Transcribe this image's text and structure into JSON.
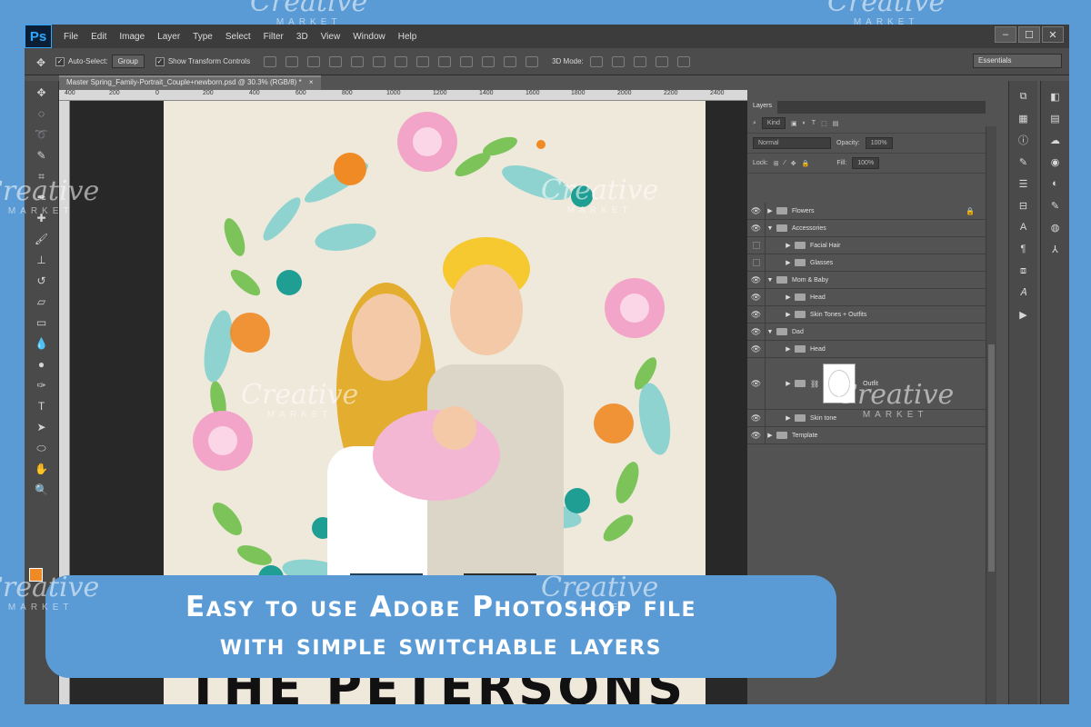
{
  "app": {
    "logo": "Ps",
    "menu": [
      "File",
      "Edit",
      "Image",
      "Layer",
      "Type",
      "Select",
      "Filter",
      "3D",
      "View",
      "Window",
      "Help"
    ],
    "window_controls": [
      "–",
      "☐",
      "✕"
    ]
  },
  "options_bar": {
    "auto_select_label": "Auto-Select:",
    "auto_select_value": "Group",
    "show_transform_label": "Show Transform Controls",
    "mode_3d_label": "3D Mode:",
    "workspace": "Essentials"
  },
  "document": {
    "tab_title": "Master Spring_Family-Portrait_Couple+newborn.psd @ 30.3% (RGB/8) *",
    "tab_close": "×",
    "ruler_ticks": [
      "400",
      "200",
      "0",
      "200",
      "400",
      "600",
      "800",
      "1000",
      "1200",
      "1400",
      "1600",
      "1800",
      "2000",
      "2200",
      "2400"
    ],
    "artwork_name_partial": "THE PETERSONS"
  },
  "layers_panel": {
    "tab": "Layers",
    "filter_kind": "Kind",
    "blend_mode": "Normal",
    "opacity_label": "Opacity:",
    "opacity_value": "100%",
    "lock_label": "Lock:",
    "fill_label": "Fill:",
    "fill_value": "100%",
    "layers": [
      {
        "name": "Flowers",
        "visible": true,
        "expanded": false,
        "locked": true
      },
      {
        "name": "Accessories",
        "visible": true,
        "expanded": true
      },
      {
        "name": "Facial Hair",
        "visible": false,
        "expanded": false
      },
      {
        "name": "Glasses",
        "visible": false,
        "expanded": false
      },
      {
        "name": "Mom & Baby",
        "visible": true,
        "expanded": true
      },
      {
        "name": "Head",
        "visible": true,
        "expanded": false
      },
      {
        "name": "Skin Tones + Outfits",
        "visible": true,
        "expanded": false
      },
      {
        "name": "Dad",
        "visible": true,
        "expanded": true
      },
      {
        "name": "Head",
        "visible": true,
        "expanded": false
      },
      {
        "name": "Outfit",
        "visible": true,
        "expanded": false,
        "has_mask": true
      },
      {
        "name": "Skin tone",
        "visible": true,
        "expanded": false
      },
      {
        "name": "Template",
        "visible": true,
        "expanded": false
      }
    ]
  },
  "banner": {
    "line1": "Easy to use Adobe Photoshop file",
    "line2": "with simple switchable layers"
  },
  "watermark": {
    "brand": "Creative",
    "sub": "MARKET"
  },
  "colors": {
    "background": "#5b9bd5",
    "foreground_swatch": "#f08a24",
    "background_swatch": "#ffffff"
  }
}
